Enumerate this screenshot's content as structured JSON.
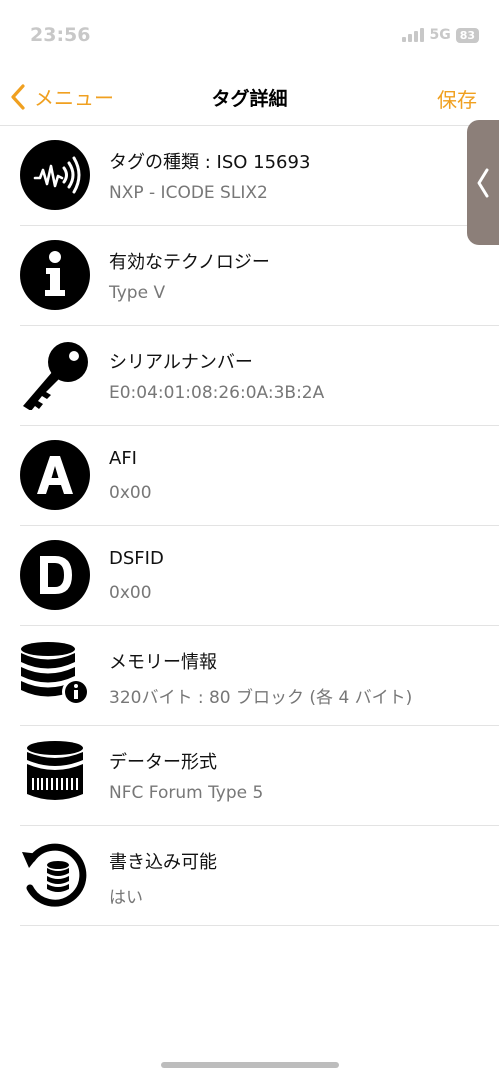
{
  "status_bar": {
    "time": "23:56",
    "network": "5G",
    "battery": "83"
  },
  "nav": {
    "back_label": "メニュー",
    "title": "タグ詳細",
    "save_label": "保存"
  },
  "colors": {
    "accent": "#f0a020",
    "sidetab": "#8c7f79"
  },
  "items": [
    {
      "icon": "nfc-signal-icon",
      "title": "タグの種類 : ISO 15693",
      "value": "NXP - ICODE SLIX2"
    },
    {
      "icon": "info-icon",
      "title": "有効なテクノロジー",
      "value": "Type V"
    },
    {
      "icon": "key-icon",
      "title": "シリアルナンバー",
      "value": "E0:04:01:08:26:0A:3B:2A"
    },
    {
      "icon": "letter-a-icon",
      "title": "AFI",
      "value": "0x00"
    },
    {
      "icon": "letter-d-icon",
      "title": "DSFID",
      "value": "0x00"
    },
    {
      "icon": "database-info-icon",
      "title": "メモリー情報",
      "value": "320バイト : 80 ブロック (各 4 バイト)"
    },
    {
      "icon": "database-barcode-icon",
      "title": "データー形式",
      "value": "NFC Forum Type 5"
    },
    {
      "icon": "database-rewrite-icon",
      "title": "書き込み可能",
      "value": "はい"
    }
  ]
}
